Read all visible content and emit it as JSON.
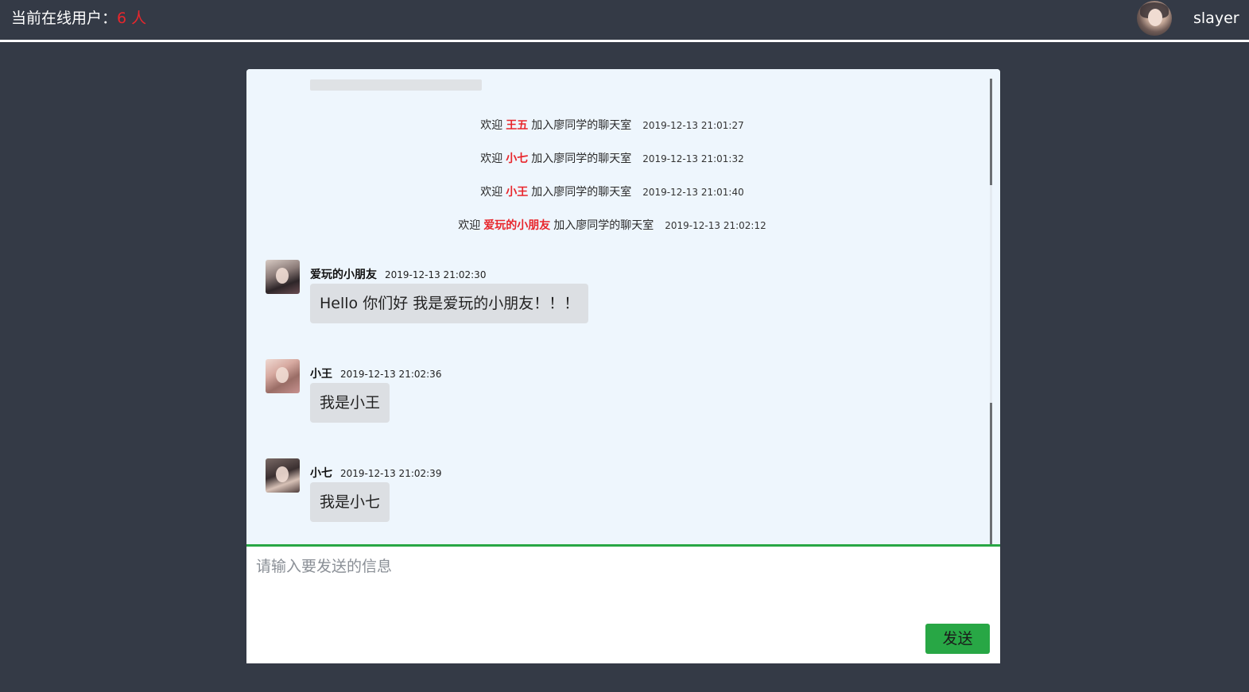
{
  "header": {
    "online_label": "当前在线用户：",
    "online_count": "6 人",
    "username": "slayer"
  },
  "system_messages": [
    {
      "prefix": "欢迎",
      "user": "王五",
      "suffix": "加入廖同学的聊天室",
      "time": "2019-12-13 21:01:27"
    },
    {
      "prefix": "欢迎",
      "user": "小七",
      "suffix": "加入廖同学的聊天室",
      "time": "2019-12-13 21:01:32"
    },
    {
      "prefix": "欢迎",
      "user": "小王",
      "suffix": "加入廖同学的聊天室",
      "time": "2019-12-13 21:01:40"
    },
    {
      "prefix": "欢迎",
      "user": "爱玩的小朋友",
      "suffix": "加入廖同学的聊天室",
      "time": "2019-12-13 21:02:12"
    }
  ],
  "messages": [
    {
      "name": "爱玩的小朋友",
      "time": "2019-12-13 21:02:30",
      "text": "Hello 你们好 我是爱玩的小朋友！！！"
    },
    {
      "name": "小王",
      "time": "2019-12-13 21:02:36",
      "text": "我是小王"
    },
    {
      "name": "小七",
      "time": "2019-12-13 21:02:39",
      "text": "我是小七"
    }
  ],
  "composer": {
    "placeholder": "请输入要发送的信息",
    "value": "",
    "send_label": "发送"
  },
  "colors": {
    "background": "#343a46",
    "highlight": "#e8262c",
    "accent": "#28a745",
    "history_bg": "#eef6fd"
  }
}
